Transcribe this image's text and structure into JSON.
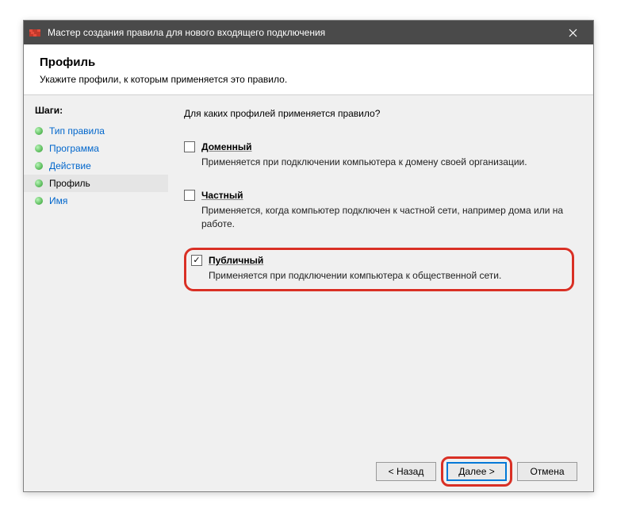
{
  "titlebar": {
    "title": "Мастер создания правила для нового входящего подключения"
  },
  "header": {
    "title": "Профиль",
    "description": "Укажите профили, к которым применяется это правило."
  },
  "steps": {
    "header": "Шаги:",
    "items": [
      {
        "label": "Тип правила",
        "link": true,
        "active": false
      },
      {
        "label": "Программа",
        "link": true,
        "active": false
      },
      {
        "label": "Действие",
        "link": true,
        "active": false
      },
      {
        "label": "Профиль",
        "link": false,
        "active": true
      },
      {
        "label": "Имя",
        "link": true,
        "active": false
      }
    ]
  },
  "content": {
    "question": "Для каких профилей применяется правило?",
    "options": [
      {
        "label": "Доменный",
        "description": "Применяется при подключении компьютера к домену своей организации.",
        "checked": false,
        "highlighted": false
      },
      {
        "label": "Частный",
        "description": "Применяется, когда компьютер подключен к частной сети, например дома или на работе.",
        "checked": false,
        "highlighted": false
      },
      {
        "label": "Публичный",
        "description": "Применяется при подключении компьютера к общественной сети.",
        "checked": true,
        "highlighted": true
      }
    ]
  },
  "footer": {
    "back": "< Назад",
    "next": "Далее >",
    "cancel": "Отмена"
  }
}
